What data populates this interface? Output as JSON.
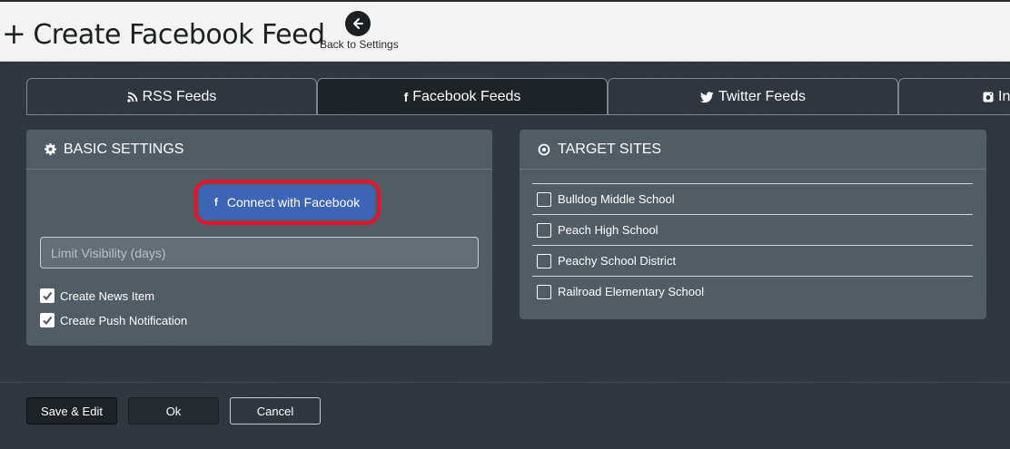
{
  "header": {
    "plus": "+",
    "title": "Create Facebook Feed",
    "back_label": "Back to Settings"
  },
  "tabs": [
    {
      "label": "RSS Feeds",
      "icon": "rss-icon"
    },
    {
      "label": "Facebook Feeds",
      "icon": "facebook-icon",
      "active": true
    },
    {
      "label": "Twitter Feeds",
      "icon": "twitter-icon"
    },
    {
      "label": "In",
      "icon": "instagram-icon"
    }
  ],
  "basic_settings": {
    "heading": "BASIC SETTINGS",
    "connect_label": "Connect with Facebook",
    "limit_placeholder": "Limit Visibility (days)",
    "checkboxes": [
      {
        "label": "Create News Item",
        "checked": true
      },
      {
        "label": "Create Push Notification",
        "checked": true
      }
    ]
  },
  "target_sites": {
    "heading": "TARGET SITES",
    "sites": [
      {
        "label": "Bulldog Middle School",
        "checked": false
      },
      {
        "label": "Peach High School",
        "checked": false
      },
      {
        "label": "Peachy School District",
        "checked": false
      },
      {
        "label": "Railroad Elementary School",
        "checked": false
      }
    ]
  },
  "footer": {
    "save_label": "Save & Edit",
    "ok_label": "Ok",
    "cancel_label": "Cancel"
  },
  "colors": {
    "background": "#2e353c",
    "panel": "#525c65",
    "facebook_button": "#3e65b5",
    "highlight_ring": "#e3142a"
  }
}
